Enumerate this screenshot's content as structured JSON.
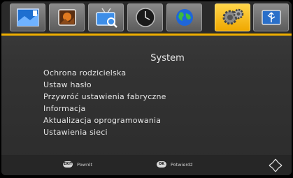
{
  "topbar": {
    "tiles": [
      {
        "icon": "picture-icon",
        "active": false
      },
      {
        "icon": "photo-icon",
        "active": false
      },
      {
        "icon": "tv-search-icon",
        "active": false
      },
      {
        "icon": "clock-icon",
        "active": false
      },
      {
        "icon": "globe-icon",
        "active": false
      },
      {
        "icon": "settings-gears-icon",
        "active": true
      },
      {
        "icon": "usb-icon",
        "active": false
      }
    ],
    "accent_color": "#f0b000"
  },
  "main": {
    "title": "System",
    "menu": [
      "Ochrona rodzicielska",
      "Ustaw hasło",
      "Przywróć ustawienia fabryczne",
      "Informacja",
      "Aktualizacja oprogramowania",
      "Ustawienia sieci"
    ]
  },
  "bottombar": {
    "exit_key": "EXIT",
    "exit_label": "Powrót",
    "ok_key": "OK",
    "ok_label": "Potwierdź",
    "nav_icon": "navigation-arrows-icon"
  }
}
